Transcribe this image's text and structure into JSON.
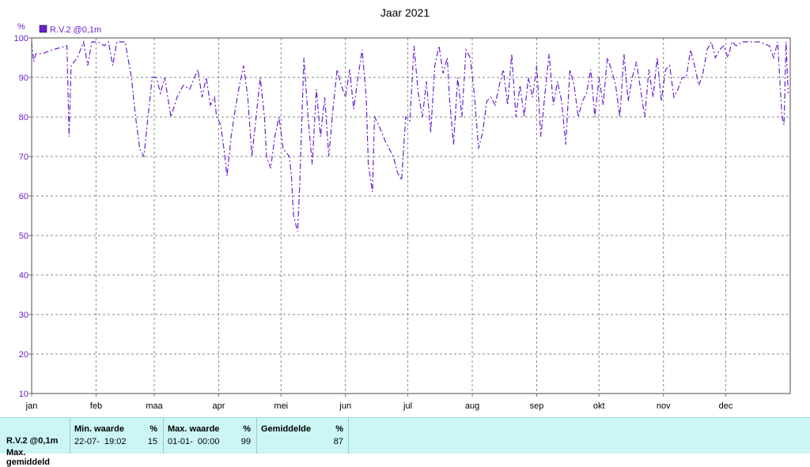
{
  "chart_data": {
    "type": "line",
    "title": "Jaar 2021",
    "ylabel": "%",
    "ylim": [
      10,
      100
    ],
    "yticks": [
      10,
      20,
      30,
      40,
      50,
      60,
      70,
      80,
      90,
      100
    ],
    "xlim": [
      0,
      365
    ],
    "xticks": [
      {
        "label": "jan",
        "day": 0
      },
      {
        "label": "feb",
        "day": 31
      },
      {
        "label": "maa",
        "day": 59
      },
      {
        "label": "apr",
        "day": 90
      },
      {
        "label": "mei",
        "day": 120
      },
      {
        "label": "jun",
        "day": 151
      },
      {
        "label": "jul",
        "day": 181
      },
      {
        "label": "aug",
        "day": 212
      },
      {
        "label": "sep",
        "day": 243
      },
      {
        "label": "okt",
        "day": 273
      },
      {
        "label": "nov",
        "day": 304
      },
      {
        "label": "dec",
        "day": 334
      }
    ],
    "grid": true,
    "legend_position": "top-left",
    "series": [
      {
        "name": "R.V.2 @0,1m",
        "color": "#6a1fd0",
        "points": [
          [
            0,
            99
          ],
          [
            1,
            94
          ],
          [
            2,
            96
          ],
          [
            5,
            96
          ],
          [
            10,
            97
          ],
          [
            17,
            98
          ],
          [
            18,
            75
          ],
          [
            19,
            93
          ],
          [
            22,
            95
          ],
          [
            25,
            99
          ],
          [
            27,
            93
          ],
          [
            29,
            99
          ],
          [
            32,
            99
          ],
          [
            35,
            98
          ],
          [
            37,
            99
          ],
          [
            39,
            93
          ],
          [
            41,
            99
          ],
          [
            45,
            99
          ],
          [
            48,
            90
          ],
          [
            50,
            80
          ],
          [
            52,
            72
          ],
          [
            54,
            70
          ],
          [
            56,
            80
          ],
          [
            58,
            90
          ],
          [
            60,
            90
          ],
          [
            62,
            86
          ],
          [
            64,
            90
          ],
          [
            67,
            80
          ],
          [
            70,
            85
          ],
          [
            73,
            88
          ],
          [
            76,
            87
          ],
          [
            80,
            92
          ],
          [
            82,
            85
          ],
          [
            84,
            90
          ],
          [
            86,
            83
          ],
          [
            88,
            85
          ],
          [
            89,
            80
          ],
          [
            91,
            78
          ],
          [
            93,
            70
          ],
          [
            94,
            65
          ],
          [
            96,
            75
          ],
          [
            98,
            82
          ],
          [
            100,
            88
          ],
          [
            102,
            93
          ],
          [
            104,
            85
          ],
          [
            106,
            70
          ],
          [
            108,
            80
          ],
          [
            110,
            90
          ],
          [
            112,
            80
          ],
          [
            113,
            70
          ],
          [
            115,
            67
          ],
          [
            117,
            75
          ],
          [
            119,
            80
          ],
          [
            121,
            72
          ],
          [
            124,
            70
          ],
          [
            125,
            65
          ],
          [
            126,
            55
          ],
          [
            128,
            51
          ],
          [
            129,
            63
          ],
          [
            131,
            95
          ],
          [
            133,
            80
          ],
          [
            135,
            68
          ],
          [
            137,
            87
          ],
          [
            139,
            75
          ],
          [
            141,
            85
          ],
          [
            143,
            70
          ],
          [
            145,
            82
          ],
          [
            147,
            92
          ],
          [
            149,
            88
          ],
          [
            151,
            85
          ],
          [
            153,
            92
          ],
          [
            155,
            82
          ],
          [
            157,
            90
          ],
          [
            159,
            97
          ],
          [
            161,
            85
          ],
          [
            162,
            68
          ],
          [
            164,
            61
          ],
          [
            165,
            80
          ],
          [
            167,
            78
          ],
          [
            170,
            74
          ],
          [
            174,
            70
          ],
          [
            176,
            66
          ],
          [
            178,
            64
          ],
          [
            180,
            80
          ],
          [
            182,
            79
          ],
          [
            184,
            98
          ],
          [
            186,
            86
          ],
          [
            188,
            80
          ],
          [
            190,
            89
          ],
          [
            192,
            76
          ],
          [
            194,
            93
          ],
          [
            196,
            98
          ],
          [
            198,
            91
          ],
          [
            200,
            95
          ],
          [
            201,
            85
          ],
          [
            203,
            73
          ],
          [
            205,
            90
          ],
          [
            207,
            80
          ],
          [
            209,
            97
          ],
          [
            211,
            95
          ],
          [
            213,
            86
          ],
          [
            215,
            72
          ],
          [
            217,
            76
          ],
          [
            219,
            84
          ],
          [
            221,
            85
          ],
          [
            223,
            83
          ],
          [
            225,
            88
          ],
          [
            227,
            92
          ],
          [
            229,
            83
          ],
          [
            231,
            96
          ],
          [
            233,
            80
          ],
          [
            235,
            88
          ],
          [
            237,
            80
          ],
          [
            239,
            90
          ],
          [
            241,
            85
          ],
          [
            243,
            93
          ],
          [
            245,
            75
          ],
          [
            247,
            86
          ],
          [
            249,
            96
          ],
          [
            251,
            83
          ],
          [
            253,
            89
          ],
          [
            255,
            84
          ],
          [
            257,
            73
          ],
          [
            259,
            92
          ],
          [
            261,
            88
          ],
          [
            263,
            80
          ],
          [
            265,
            84
          ],
          [
            267,
            86
          ],
          [
            269,
            92
          ],
          [
            271,
            80
          ],
          [
            273,
            90
          ],
          [
            275,
            83
          ],
          [
            277,
            95
          ],
          [
            279,
            92
          ],
          [
            281,
            88
          ],
          [
            283,
            80
          ],
          [
            285,
            96
          ],
          [
            287,
            84
          ],
          [
            289,
            90
          ],
          [
            291,
            94
          ],
          [
            293,
            87
          ],
          [
            295,
            80
          ],
          [
            297,
            92
          ],
          [
            299,
            85
          ],
          [
            301,
            95
          ],
          [
            303,
            84
          ],
          [
            305,
            92
          ],
          [
            307,
            93
          ],
          [
            309,
            85
          ],
          [
            311,
            87
          ],
          [
            313,
            90
          ],
          [
            315,
            90
          ],
          [
            317,
            97
          ],
          [
            319,
            93
          ],
          [
            321,
            88
          ],
          [
            323,
            91
          ],
          [
            325,
            97
          ],
          [
            327,
            99
          ],
          [
            329,
            95
          ],
          [
            331,
            97
          ],
          [
            333,
            98
          ],
          [
            335,
            95
          ],
          [
            337,
            99
          ],
          [
            339,
            98
          ],
          [
            342,
            99
          ],
          [
            345,
            99
          ],
          [
            350,
            99
          ],
          [
            355,
            98
          ],
          [
            357,
            95
          ],
          [
            359,
            99
          ],
          [
            361,
            80
          ],
          [
            362,
            78
          ],
          [
            363,
            99
          ],
          [
            364,
            86
          ]
        ]
      }
    ]
  },
  "stats": {
    "series_label": "R.V.2 @0,1m",
    "second_label": "Max. gemiddeld",
    "min": {
      "header": "Min. waarde",
      "unit": "%",
      "time": "22-07-  19:02",
      "value": "15"
    },
    "max": {
      "header": "Max. waarde",
      "unit": "%",
      "time": "01-01-  00:00",
      "value": "99"
    },
    "avg": {
      "header": "Gemiddelde",
      "unit": "%",
      "value": "87"
    }
  }
}
